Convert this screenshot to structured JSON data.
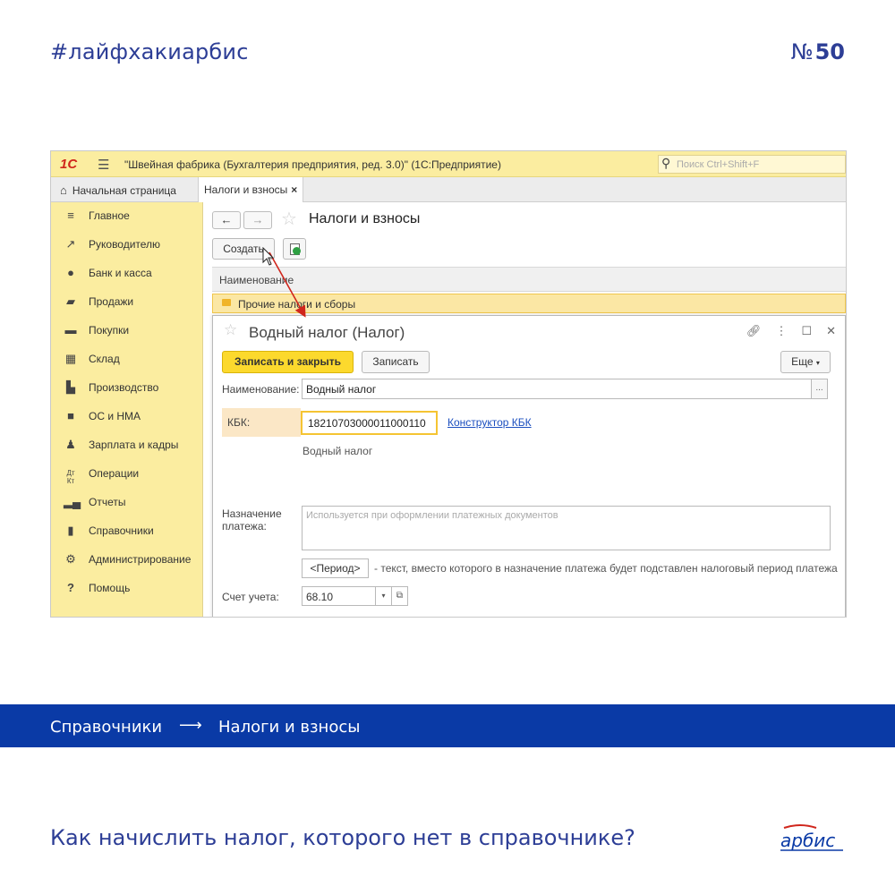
{
  "poster": {
    "hashtag": "#лайфхакиарбис",
    "issue_prefix": "№",
    "issue_number": "50",
    "breadcrumb_from": "Справочники",
    "breadcrumb_arrow": "⟶",
    "breadcrumb_to": "Налоги и взносы",
    "question": "Как начислить налог, которого нет в справочнике?",
    "brand_logo_text": "арбис",
    "accent_color": "#0a3aa6",
    "text_color": "#2d3e96"
  },
  "app": {
    "logo": "1С",
    "title": "\"Швейная фабрика (Бухгалтерия предприятия, ред. 3.0)\"  (1С:Предприятие)",
    "search_placeholder": "Поиск Ctrl+Shift+F",
    "tabs": [
      {
        "label": "Начальная страница"
      },
      {
        "label": "Налоги и взносы",
        "close": "×"
      }
    ]
  },
  "sidebar": {
    "items": [
      {
        "label": "Главное",
        "icon": "menu-icon"
      },
      {
        "label": "Руководителю",
        "icon": "trend-icon"
      },
      {
        "label": "Банк и касса",
        "icon": "coin-icon"
      },
      {
        "label": "Продажи",
        "icon": "bag-icon"
      },
      {
        "label": "Покупки",
        "icon": "cart-icon"
      },
      {
        "label": "Склад",
        "icon": "warehouse-icon"
      },
      {
        "label": "Производство",
        "icon": "factory-icon"
      },
      {
        "label": "ОС и НМА",
        "icon": "truck-icon"
      },
      {
        "label": "Зарплата и кадры",
        "icon": "person-icon"
      },
      {
        "label": "Операции",
        "icon": "dt-kt-icon"
      },
      {
        "label": "Отчеты",
        "icon": "bar-chart-icon"
      },
      {
        "label": "Справочники",
        "icon": "books-icon"
      },
      {
        "label": "Администрирование",
        "icon": "gear-icon"
      },
      {
        "label": "Помощь",
        "icon": "help-icon"
      }
    ]
  },
  "list": {
    "page_title": "Налоги и взносы",
    "create_label": "Создать",
    "column_name": "Наименование",
    "rows": [
      {
        "label": "Прочие налоги и сборы"
      }
    ]
  },
  "dialog": {
    "title": "Водный налог (Налог)",
    "save_close_label": "Записать и закрыть",
    "save_label": "Записать",
    "more_label": "Еще",
    "name_label": "Наименование:",
    "name_value": "Водный налог",
    "kbk_label": "КБК:",
    "kbk_value": "18210703000011000110",
    "kbk_link": "Конструктор КБК",
    "kbk_description": "Водный налог",
    "payment_purpose_label_1": "Назначение",
    "payment_purpose_label_2": "платежа:",
    "payment_purpose_placeholder": "Используется при оформлении платежных документов",
    "period_button": "<Период>",
    "period_note": "- текст, вместо которого в назначение платежа будет подставлен налоговый период платежа",
    "account_label": "Счет учета:",
    "account_value": "68.10"
  }
}
